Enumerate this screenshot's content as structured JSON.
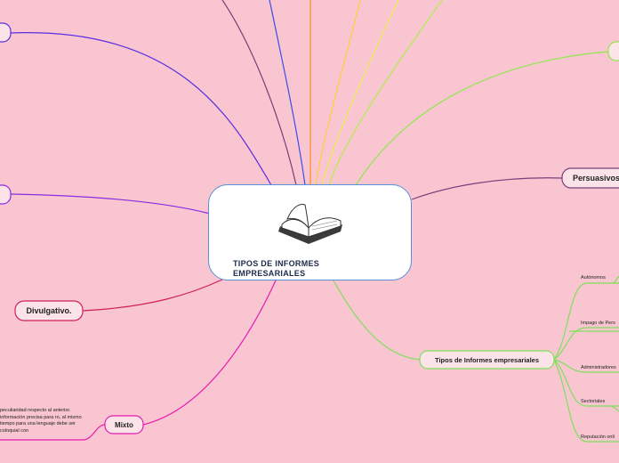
{
  "center": {
    "title": "TIPOS DE INFORMES EMPRESARIALES",
    "icon": "open-book-icon"
  },
  "branches": {
    "persuasivos": "Persuasivos",
    "divulgativo": "Divulgativo.",
    "mixto": "Mixto",
    "tipos": "Tipos de Informes empresariales"
  },
  "tipos_children": [
    "Autónomos",
    "Impago de Pers",
    "Administradores",
    "Sectoriales",
    "Reputación onli"
  ],
  "mixto_note": "peculiaridad respecto al anterior. información precisa para ro, al mismo tiempo para una lenguaje debe ser coloquial con",
  "colors": {
    "background": "#f9c5d1",
    "center_border": "#5b8fd6",
    "green": "#7ee05a",
    "purple": "#7a3f7a",
    "magenta": "#e02090",
    "crimson": "#d0205a",
    "violet": "#8a2be2",
    "blue": "#3a4de8",
    "orange": "#ff8c1a",
    "yellow": "#ffd23a"
  }
}
